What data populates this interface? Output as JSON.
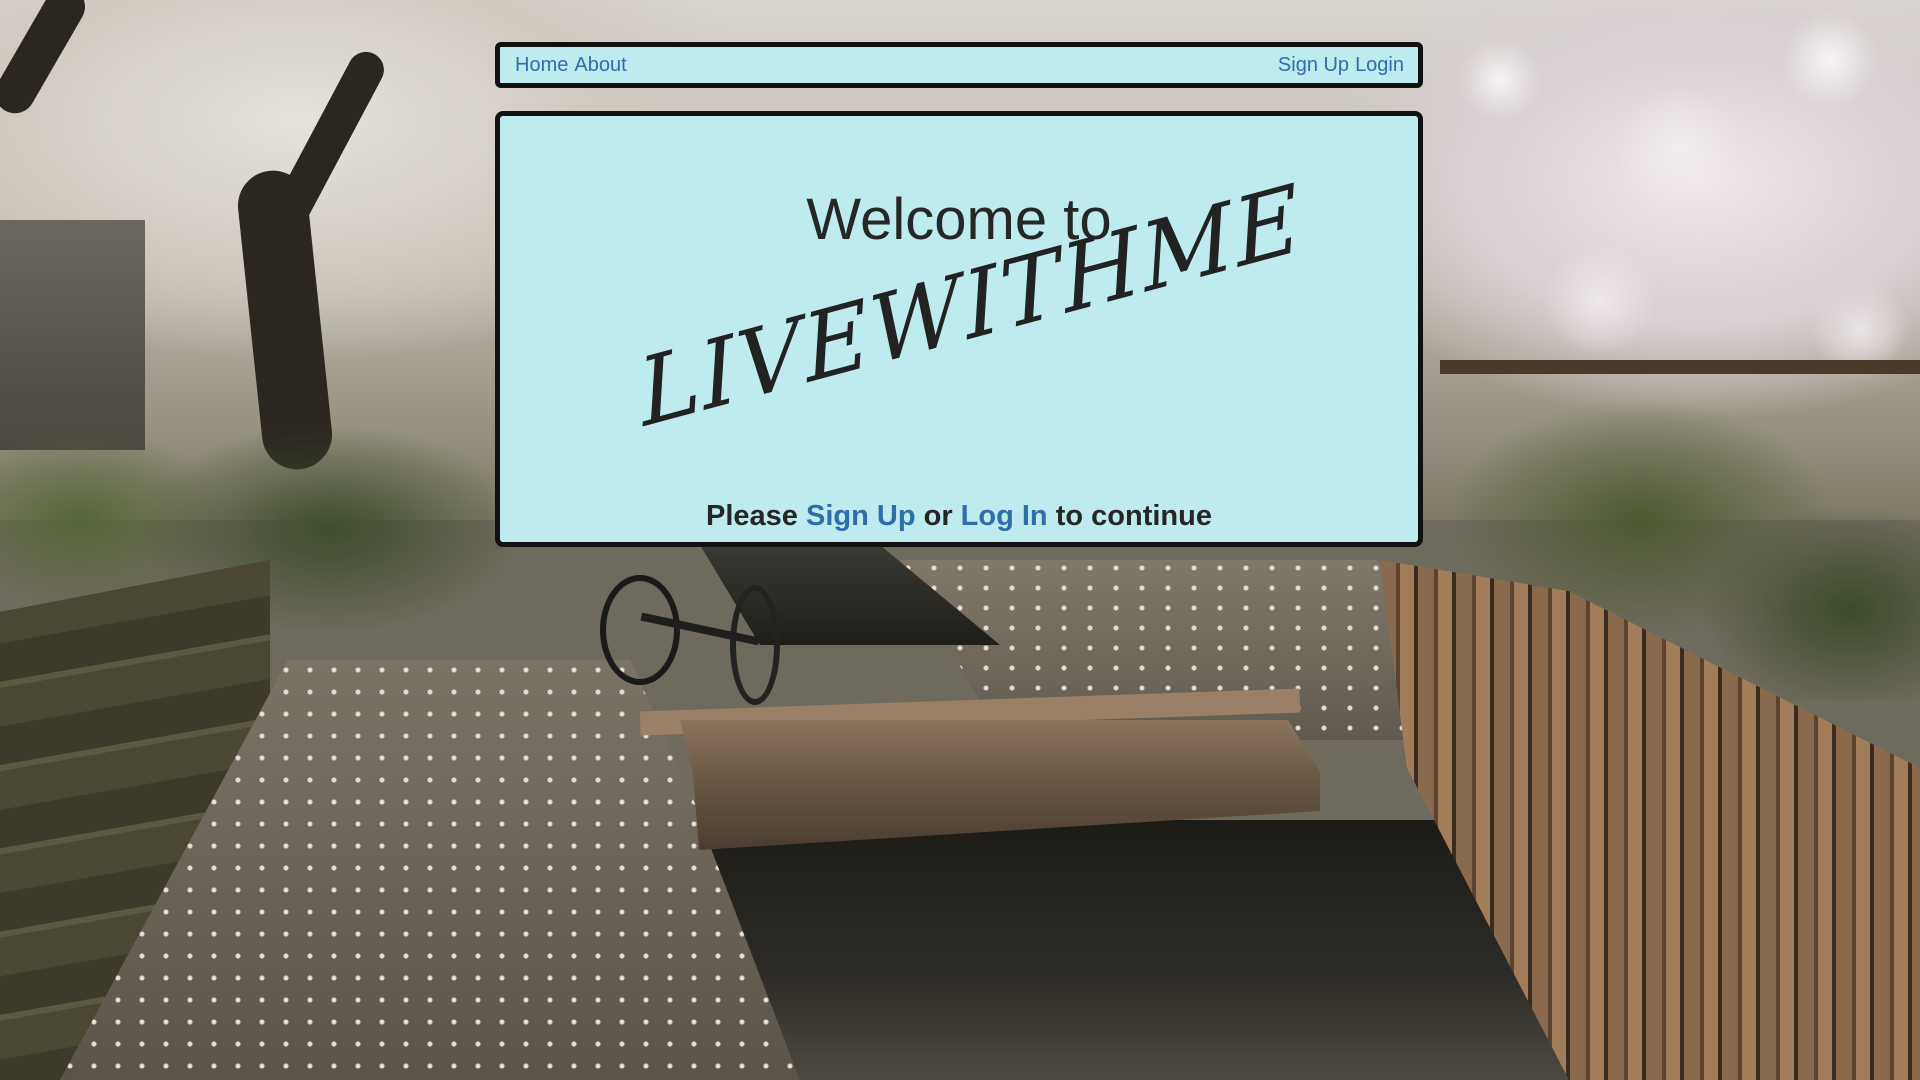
{
  "navbar": {
    "left_links": [
      "Home",
      "About"
    ],
    "right_links": [
      "Sign Up",
      "Login"
    ]
  },
  "hero": {
    "welcome_text": "Welcome to",
    "brand_name": "LIVEWITHME",
    "cta": {
      "prefix": "Please",
      "signup_link": "Sign Up",
      "middle": "or",
      "login_link": "Log In",
      "suffix": "to continue"
    }
  },
  "colors": {
    "panel_background": "#bdebee",
    "panel_border": "#111111",
    "link": "#2f6ea8",
    "text": "#262626"
  }
}
